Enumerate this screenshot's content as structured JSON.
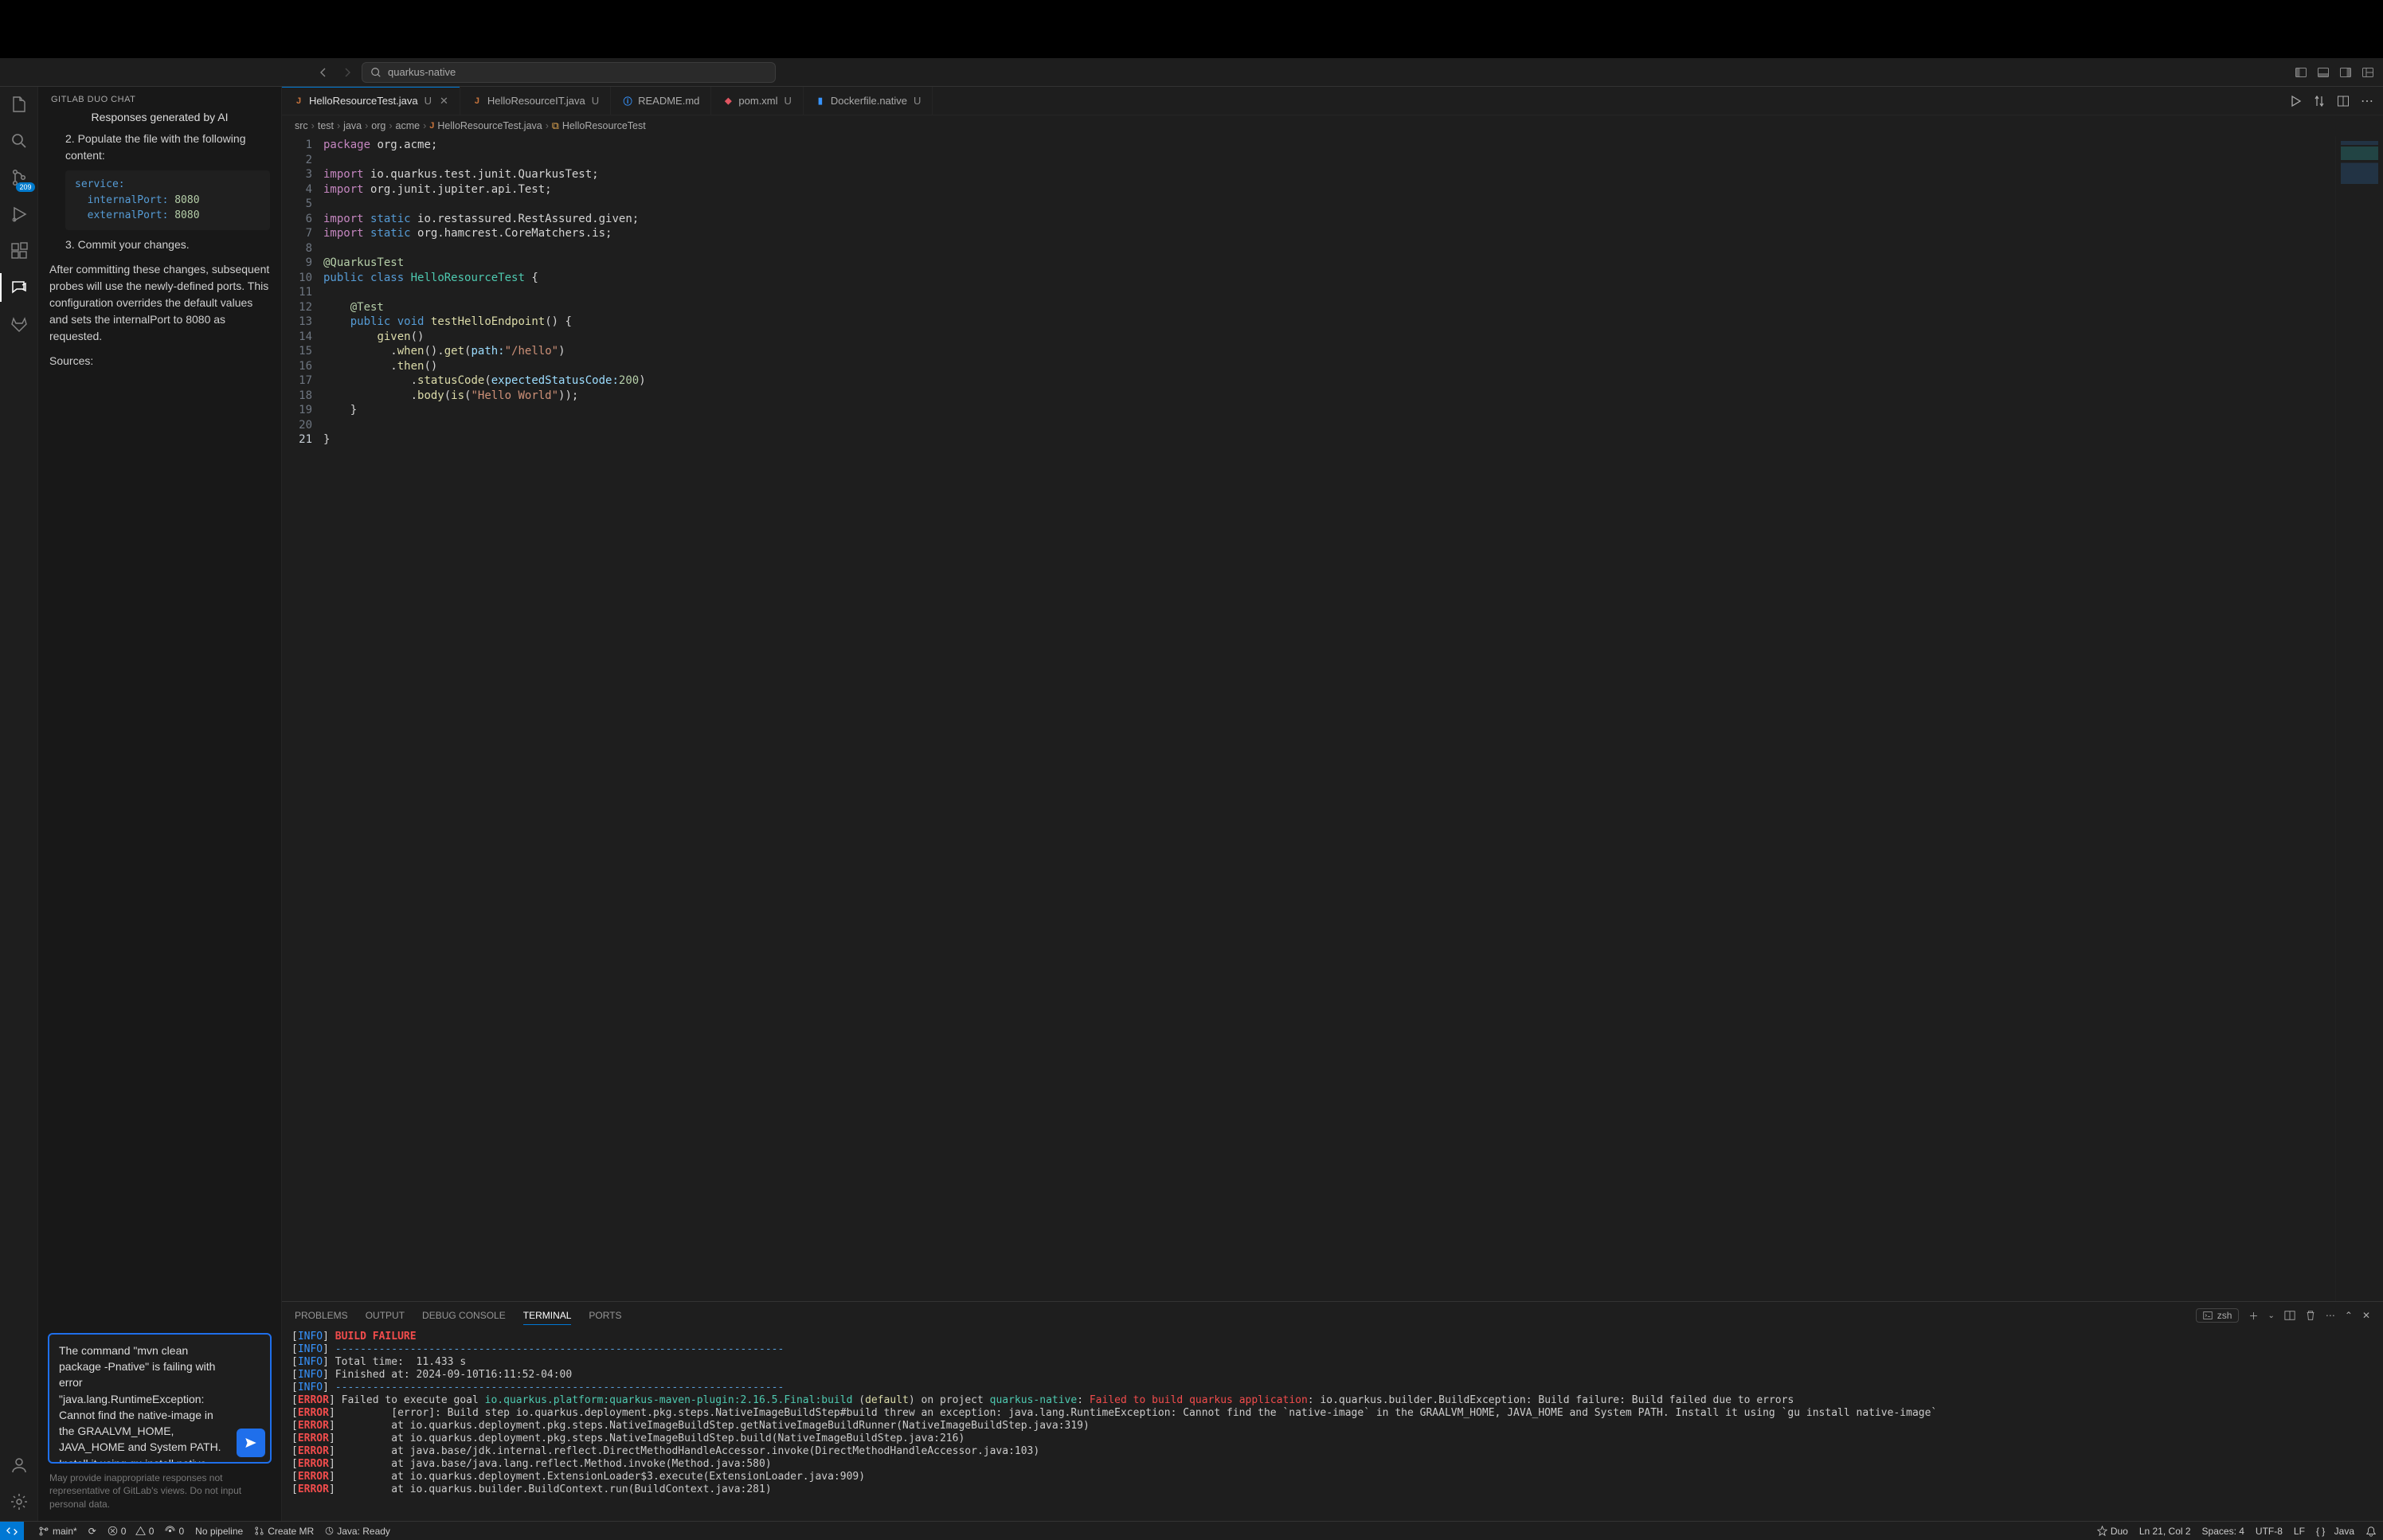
{
  "search": {
    "placeholder": "quarkus-native"
  },
  "activity_badge": "209",
  "chat": {
    "title": "GITLAB DUO CHAT",
    "header": "Responses generated by AI",
    "step2_prefix": "2. Populate the file with the following content:",
    "code_line1_key": "service:",
    "code_line2_key": "  internalPort:",
    "code_line2_val": " 8080",
    "code_line3_key": "  externalPort:",
    "code_line3_val": " 8080",
    "step3": "3. Commit your changes.",
    "paragraph": "After committing these changes, subsequent probes will use the newly-defined ports. This configuration overrides the default values and sets the internalPort to 8080 as requested.",
    "sources": "Sources:",
    "input_value": "The command \"mvn clean package -Pnative\" is failing with error \"java.lang.RuntimeException: Cannot find the native-image in the GRAALVM_HOME, JAVA_HOME and System PATH. Install it using gu install native-image\". I'm using a MacOS Sonoma. How do I fix this error",
    "disclaimer": "May provide inappropriate responses not representative of GitLab's views. Do not input personal data."
  },
  "tabs": [
    {
      "icon": "java",
      "label": "HelloResourceTest.java",
      "mod": "U",
      "active": true,
      "close": true
    },
    {
      "icon": "java",
      "label": "HelloResourceIT.java",
      "mod": "U",
      "active": false
    },
    {
      "icon": "info",
      "label": "README.md",
      "mod": "",
      "active": false
    },
    {
      "icon": "xml",
      "label": "pom.xml",
      "mod": "U",
      "active": false
    },
    {
      "icon": "docker",
      "label": "Dockerfile.native",
      "mod": "U",
      "active": false
    }
  ],
  "breadcrumb": {
    "parts": [
      "src",
      "test",
      "java",
      "org",
      "acme"
    ],
    "file": "HelloResourceTest.java",
    "symbol": "HelloResourceTest"
  },
  "code": {
    "lines": 21
  },
  "panel": {
    "tabs": [
      "PROBLEMS",
      "OUTPUT",
      "DEBUG CONSOLE",
      "TERMINAL",
      "PORTS"
    ],
    "active": "TERMINAL",
    "shell": "zsh"
  },
  "terminal": {
    "build_failure": "BUILD FAILURE",
    "dashes": "------------------------------------------------------------------------",
    "total_time": "Total time:  11.433 s",
    "finished": "Finished at: 2024-09-10T16:11:52-04:00",
    "err1_a": "Failed to execute goal ",
    "err1_b": "io.quarkus.platform:quarkus-maven-plugin:2.16.5.Final:build",
    "err1_c": " (",
    "err1_d": "default",
    "err1_e": ") on project ",
    "err1_f": "quarkus-native",
    "err1_g": ": ",
    "err1_h": "Failed to build quarkus application",
    "err1_i": ": io.quarkus.builder.BuildException: Build failure: Build failed due to errors",
    "err2": "        [error]: Build step io.quarkus.deployment.pkg.steps.NativeImageBuildStep#build threw an exception: java.lang.RuntimeException: Cannot find the `native-image` in the GRAALVM_HOME, JAVA_HOME and System PATH. Install it using `gu install native-image`",
    "err3": "        at io.quarkus.deployment.pkg.steps.NativeImageBuildStep.getNativeImageBuildRunner(NativeImageBuildStep.java:319)",
    "err4": "        at io.quarkus.deployment.pkg.steps.NativeImageBuildStep.build(NativeImageBuildStep.java:216)",
    "err5": "        at java.base/jdk.internal.reflect.DirectMethodHandleAccessor.invoke(DirectMethodHandleAccessor.java:103)",
    "err6": "        at java.base/java.lang.reflect.Method.invoke(Method.java:580)",
    "err7": "        at io.quarkus.deployment.ExtensionLoader$3.execute(ExtensionLoader.java:909)",
    "err8": "        at io.quarkus.builder.BuildContext.run(BuildContext.java:281)"
  },
  "status": {
    "branch": "main*",
    "sync": "⟳",
    "errors": "0",
    "warnings": "0",
    "ports": "0",
    "pipeline": "No pipeline",
    "mr": "Create MR",
    "java": "Java: Ready",
    "duo": "Duo",
    "pos": "Ln 21, Col 2",
    "spaces": "Spaces: 4",
    "enc": "UTF-8",
    "eol": "LF",
    "lang": "Java",
    "lang_icon": "{ }"
  }
}
